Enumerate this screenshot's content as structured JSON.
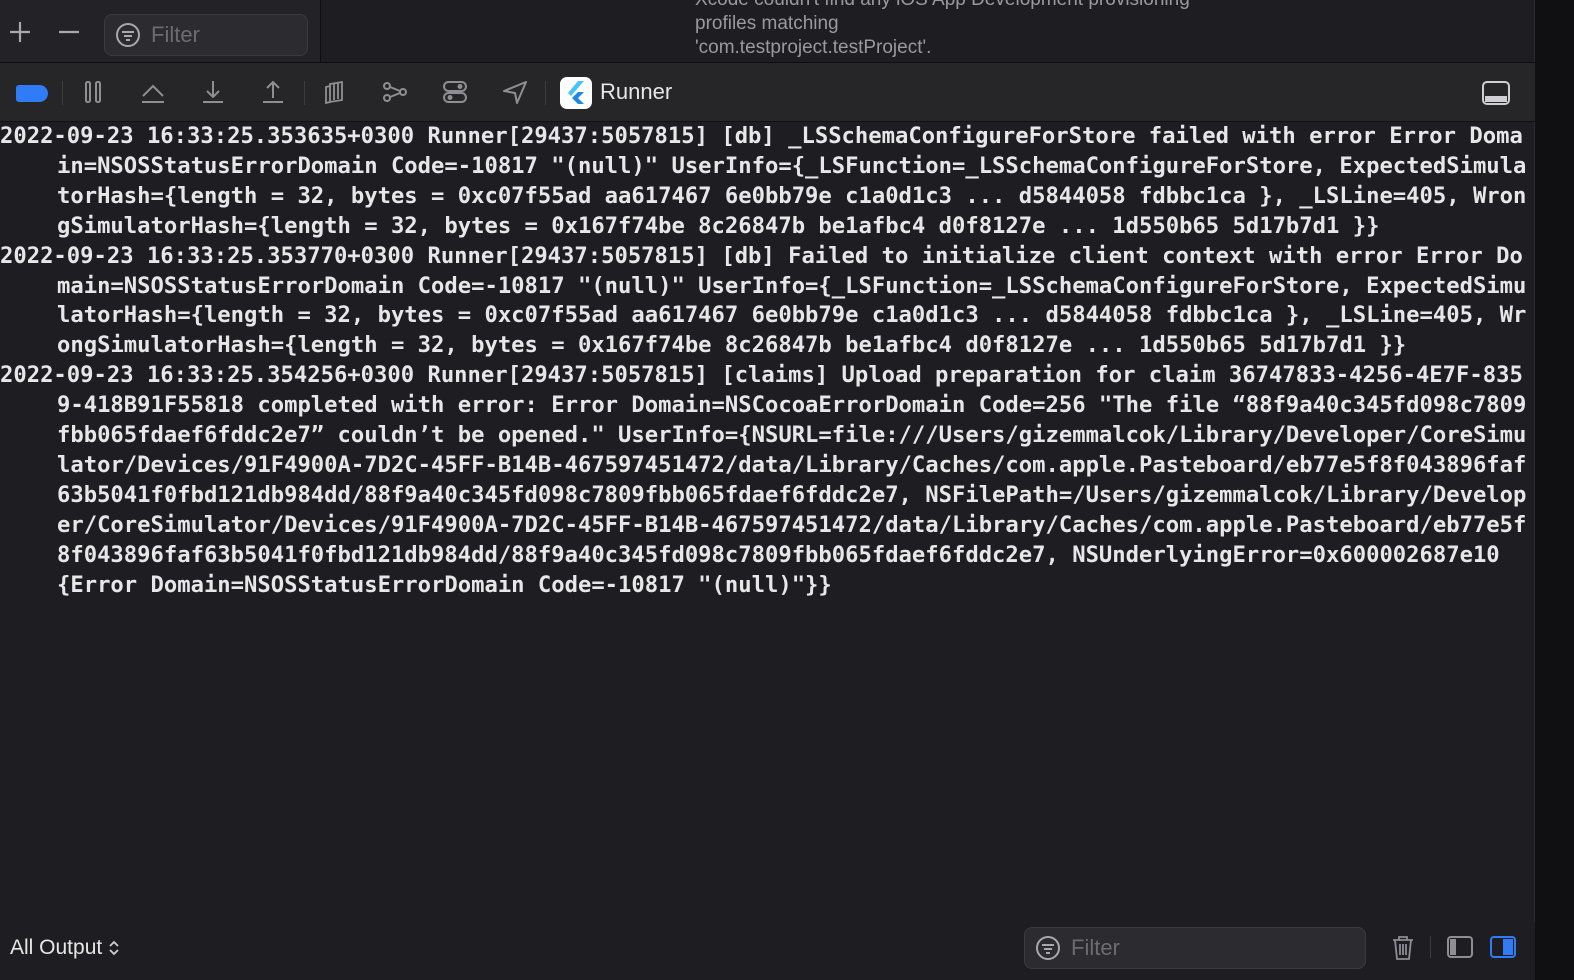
{
  "navigator": {
    "filter_placeholder": "Filter"
  },
  "issue": {
    "text": "Xcode couldn't find any iOS App Development provisioning profiles matching\n'com.testproject.testProject'."
  },
  "debug_bar": {
    "scheme_name": "Runner",
    "accent_color": "#2f7cf6"
  },
  "console": {
    "entries": [
      "2022-09-23 16:33:25.353635+0300 Runner[29437:5057815] [db] _LSSchemaConfigureForStore failed with error Error Domain=NSOSStatusErrorDomain Code=-10817 \"(null)\" UserInfo={_LSFunction=_LSSchemaConfigureForStore, ExpectedSimulatorHash={length = 32, bytes = 0xc07f55ad aa617467 6e0bb79e c1a0d1c3 ... d5844058 fdbbc1ca }, _LSLine=405, WrongSimulatorHash={length = 32, bytes = 0x167f74be 8c26847b be1afbc4 d0f8127e ... 1d550b65 5d17b7d1 }}",
      "2022-09-23 16:33:25.353770+0300 Runner[29437:5057815] [db] Failed to initialize client context with error Error Domain=NSOSStatusErrorDomain Code=-10817 \"(null)\" UserInfo={_LSFunction=_LSSchemaConfigureForStore, ExpectedSimulatorHash={length = 32, bytes = 0xc07f55ad aa617467 6e0bb79e c1a0d1c3 ... d5844058 fdbbc1ca }, _LSLine=405, WrongSimulatorHash={length = 32, bytes = 0x167f74be 8c26847b be1afbc4 d0f8127e ... 1d550b65 5d17b7d1 }}",
      "2022-09-23 16:33:25.354256+0300 Runner[29437:5057815] [claims] Upload preparation for claim 36747833-4256-4E7F-8359-418B91F55818 completed with error: Error Domain=NSCocoaErrorDomain Code=256 \"The file “88f9a40c345fd098c7809fbb065fdaef6fddc2e7” couldn’t be opened.\" UserInfo={NSURL=file:///Users/gizemmalcok/Library/Developer/CoreSimulator/Devices/91F4900A-7D2C-45FF-B14B-467597451472/data/Library/Caches/com.apple.Pasteboard/eb77e5f8f043896faf63b5041f0fbd121db984dd/88f9a40c345fd098c7809fbb065fdaef6fddc2e7, NSFilePath=/Users/gizemmalcok/Library/Developer/CoreSimulator/Devices/91F4900A-7D2C-45FF-B14B-467597451472/data/Library/Caches/com.apple.Pasteboard/eb77e5f8f043896faf63b5041f0fbd121db984dd/88f9a40c345fd098c7809fbb065fdaef6fddc2e7, NSUnderlyingError=0x600002687e10 {Error Domain=NSOSStatusErrorDomain Code=-10817 \"(null)\"}}"
    ]
  },
  "bottom_bar": {
    "output_selector": "All Output",
    "filter_placeholder": "Filter"
  }
}
